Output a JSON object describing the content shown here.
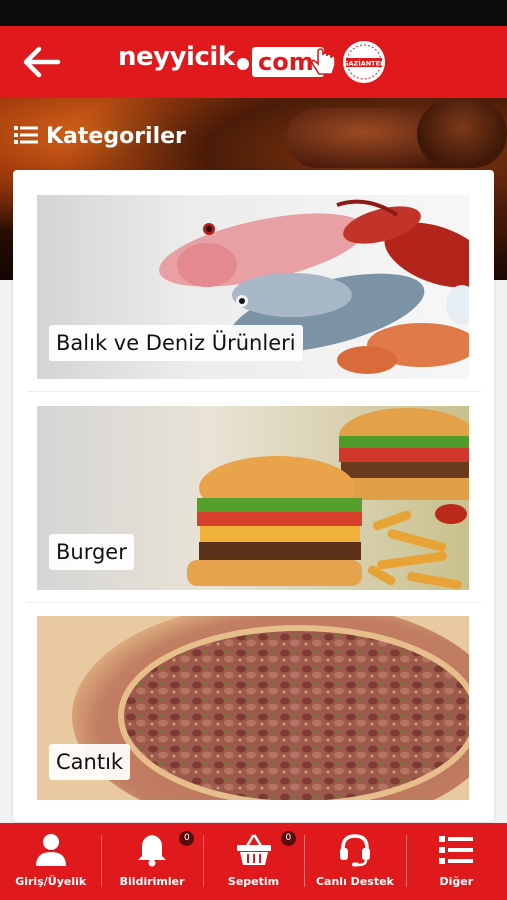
{
  "header": {
    "logo_text": "neyyicik",
    "logo_com": "com",
    "seal_text": "GAZİANTEP"
  },
  "categories_heading": "Kategoriler",
  "categories": [
    {
      "label": "Balık ve Deniz Ürünleri"
    },
    {
      "label": "Burger"
    },
    {
      "label": "Cantık"
    }
  ],
  "bottom_nav": [
    {
      "label": "Giriş/Üyelik",
      "icon": "user-icon"
    },
    {
      "label": "Bildirimler",
      "icon": "bell-icon",
      "badge": "0"
    },
    {
      "label": "Sepetim",
      "icon": "basket-icon",
      "badge": "0"
    },
    {
      "label": "Canlı Destek",
      "icon": "headset-icon"
    },
    {
      "label": "Diğer",
      "icon": "list-icon"
    }
  ],
  "colors": {
    "brand": "#e0191c",
    "badge": "#5a0b0c"
  }
}
